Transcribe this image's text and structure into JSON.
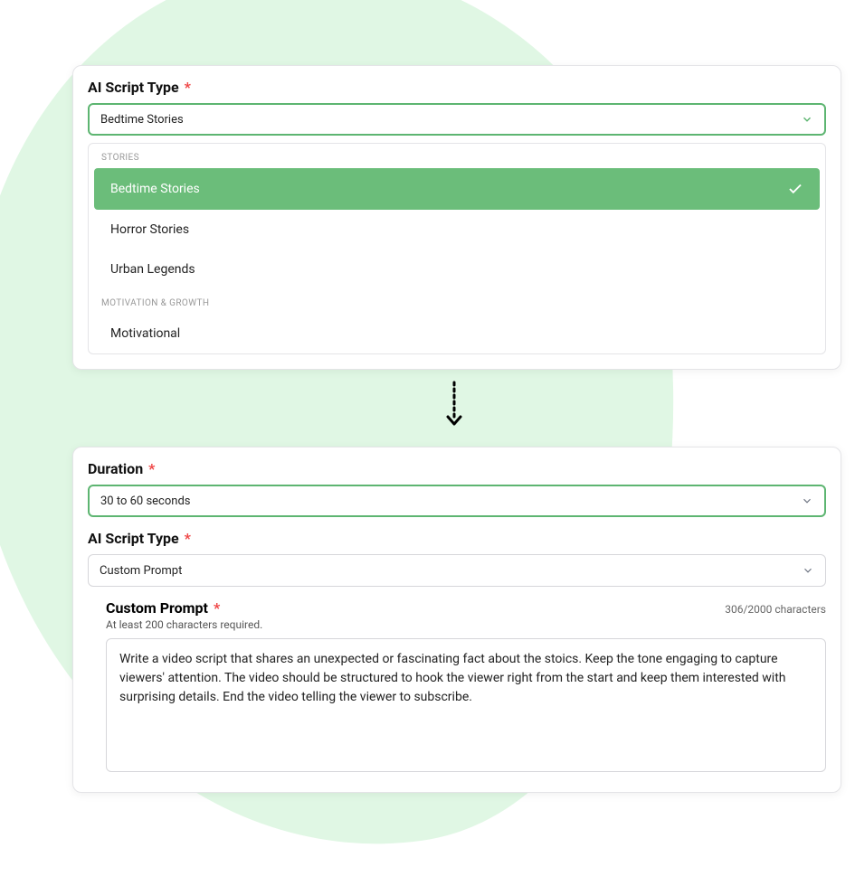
{
  "card1": {
    "label": "AI Script Type",
    "required": "*",
    "select_value": "Bedtime Stories",
    "group1_label": "STORIES",
    "options": {
      "o1": "Bedtime Stories",
      "o2": "Horror Stories",
      "o3": "Urban Legends"
    },
    "group2_label": "MOTIVATION & GROWTH",
    "options2": {
      "o4": "Motivational"
    }
  },
  "card2": {
    "duration_label": "Duration",
    "duration_required": "*",
    "duration_value": "30 to 60 seconds",
    "script_type_label": "AI Script Type",
    "script_type_required": "*",
    "script_type_value": "Custom Prompt",
    "custom_title": "Custom Prompt",
    "custom_required": "*",
    "char_count": "306/2000 characters",
    "hint": "At least 200 characters required.",
    "textarea_value": "Write a video script that shares an unexpected or fascinating fact about the stoics. Keep the tone engaging to capture viewers' attention. The video should be structured to hook the viewer right from the start and keep them interested with surprising details. End the video telling the viewer to subscribe."
  }
}
